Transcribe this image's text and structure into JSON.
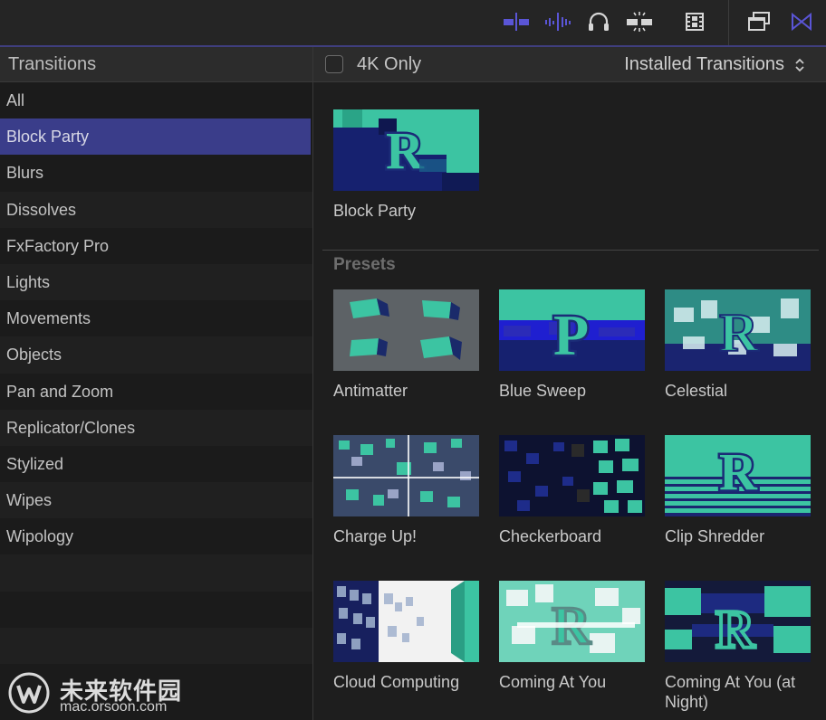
{
  "toolbar": {
    "icons": [
      "skimming-icon",
      "audio-skimming-icon",
      "headphones-icon",
      "snapping-icon",
      "filmstrip-icon",
      "browser-window-icon",
      "transitions-browser-icon"
    ]
  },
  "sidebar": {
    "title": "Transitions",
    "items": [
      {
        "label": "All"
      },
      {
        "label": "Block Party",
        "selected": true
      },
      {
        "label": "Blurs"
      },
      {
        "label": "Dissolves"
      },
      {
        "label": "FxFactory Pro"
      },
      {
        "label": "Lights"
      },
      {
        "label": "Movements"
      },
      {
        "label": "Objects"
      },
      {
        "label": "Pan and Zoom"
      },
      {
        "label": "Replicator/Clones"
      },
      {
        "label": "Stylized"
      },
      {
        "label": "Wipes"
      },
      {
        "label": "Wipology"
      }
    ]
  },
  "main": {
    "filter_label": "4K Only",
    "filter_checked": false,
    "source_select": "Installed Transitions",
    "featured": {
      "label": "Block Party"
    },
    "presets_title": "Presets",
    "presets": [
      {
        "label": "Antimatter"
      },
      {
        "label": "Blue Sweep"
      },
      {
        "label": "Celestial"
      },
      {
        "label": "Charge Up!"
      },
      {
        "label": "Checkerboard"
      },
      {
        "label": "Clip Shredder"
      },
      {
        "label": "Cloud Computing"
      },
      {
        "label": "Coming At You"
      },
      {
        "label": "Coming At You (at Night)"
      }
    ]
  },
  "watermark": {
    "name": "未来软件园",
    "url": "mac.orsoon.com"
  },
  "colors": {
    "accent": "#5a55d6",
    "selection": "#3a3d8a",
    "teal": "#3ec6a3",
    "navy": "#14206e"
  }
}
